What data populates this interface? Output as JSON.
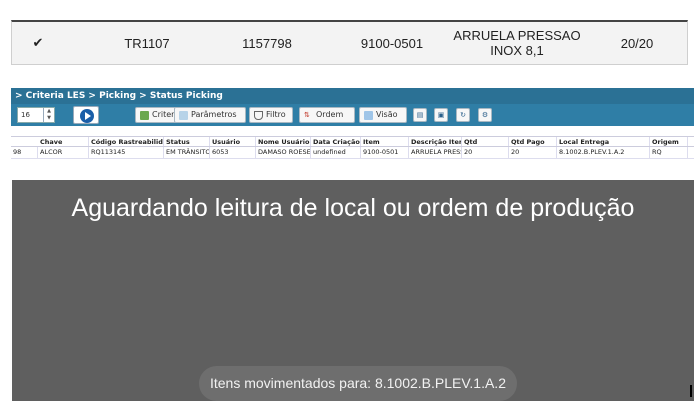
{
  "top_row": {
    "check_icon": "double-check-icon",
    "check_glyph": "✔",
    "code": "TR1107",
    "number": "1157798",
    "item": "9100-0501",
    "description": "ARRUELA PRESSAO\nINOX  8,1",
    "quantity": "20/20"
  },
  "les": {
    "breadcrumb": "> Criteria LES > Picking > Status Picking",
    "toolbar": {
      "page_size": "16",
      "buttons": {
        "criteria": "Criteria",
        "parametros": "Parâmetros",
        "filtro": "Filtro",
        "ordem": "Ordem",
        "visao": "Visão"
      }
    },
    "columns": [
      "Chave",
      "Código Rastreabilidade",
      "Status",
      "Usuário",
      "Nome Usuário",
      "Data Criação",
      "Item",
      "Descrição Item",
      "Qtd",
      "Qtd Pago",
      "Local Entrega",
      "Origem"
    ],
    "row": {
      "index": "98",
      "cells": [
        "ALCOR",
        "RQ113145",
        "EM TRÂNSITO",
        "6053",
        "DAMASO ROESE",
        "undefined",
        "9100-0501",
        "ARRUELA PRESS",
        "20",
        "20",
        "8.1002.B.PLEV.1.A.2",
        "RQ"
      ]
    }
  },
  "android": {
    "message": "Aguardando leitura de local ou ordem de produção",
    "toast": "Itens movimentados para: 8.1002.B.PLEV.1.A.2"
  },
  "colors": {
    "les_header": "#2b7195",
    "android_bg": "#5f5f5f"
  }
}
